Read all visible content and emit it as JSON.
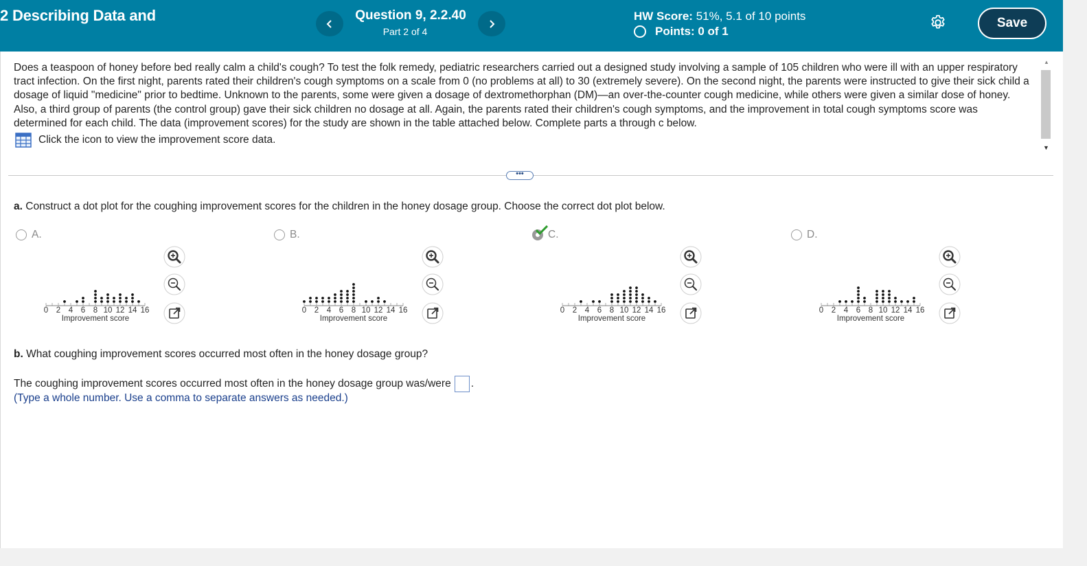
{
  "header": {
    "title": "2 Describing Data and",
    "question_title": "Question 9, 2.2.40",
    "question_part": "Part 2 of 4",
    "prev_icon": "chevron-left-icon",
    "next_icon": "chevron-right-icon",
    "hw_score_label": "HW Score:",
    "hw_score_value": "51%, 5.1 of 10 points",
    "points_text": "Points: 0 of 1",
    "settings_icon": "gear-icon",
    "save_label": "Save",
    "accent_color": "#007fa3"
  },
  "question": {
    "intro": "Does a teaspoon of honey before bed really calm a child's cough? To test the folk remedy, pediatric researchers carried out a designed study involving a sample of 105 children who were ill with an upper respiratory tract infection. On the first night, parents rated their children's cough symptoms on a scale from 0 (no problems at all) to 30 (extremely severe). On the second night, the parents were instructed to give their sick child a dosage of liquid \"medicine\" prior to bedtime. Unknown to the parents, some were given a dosage of dextromethorphan (DM)—an over-the-counter cough medicine, while others were given a similar dose of honey. Also, a third group of parents (the control group) gave their sick children no dosage at all. Again, the parents rated their children's cough symptoms, and the improvement in total cough symptoms score was determined for each child. The data (improvement scores) for the study are shown in the table attached below. Complete parts a through c below.",
    "data_link": "Click the icon to view the improvement score data.",
    "more_label": "•••",
    "part_a_letter": "a.",
    "part_a_text": "Construct a dot plot for the coughing improvement scores for the children in the honey dosage group. Choose the correct dot plot below.",
    "part_b_letter": "b.",
    "part_b_text": "What coughing improvement scores occurred most often in the honey dosage group?",
    "answer_prefix": "The coughing improvement scores occurred most often in the honey dosage group was/were",
    "answer_value": "",
    "answer_suffix": ".",
    "hint": "(Type a whole number. Use a comma to separate answers as needed.)"
  },
  "choices": [
    {
      "letter": "A.",
      "selected": false
    },
    {
      "letter": "B.",
      "selected": false
    },
    {
      "letter": "C.",
      "selected": true,
      "marked_correct": true
    },
    {
      "letter": "D.",
      "selected": false
    }
  ],
  "chart_data": [
    {
      "type": "scatter",
      "choice": "A",
      "xlabel": "Improvement score",
      "xticks": [
        "0",
        "2",
        "4",
        "6",
        "8",
        "10",
        "12",
        "14",
        "16"
      ],
      "xlim": [
        0,
        16
      ],
      "counts": {
        "3": 1,
        "5": 1,
        "6": 2,
        "8": 4,
        "9": 2,
        "10": 3,
        "11": 2,
        "12": 3,
        "13": 2,
        "14": 3,
        "15": 1
      }
    },
    {
      "type": "scatter",
      "choice": "B",
      "xlabel": "Improvement score",
      "xticks": [
        "0",
        "2",
        "4",
        "6",
        "8",
        "10",
        "12",
        "14",
        "16"
      ],
      "xlim": [
        0,
        16
      ],
      "counts": {
        "0": 1,
        "1": 2,
        "2": 2,
        "3": 2,
        "4": 2,
        "5": 3,
        "6": 4,
        "7": 4,
        "8": 6,
        "10": 1,
        "11": 1,
        "12": 2,
        "13": 1
      }
    },
    {
      "type": "scatter",
      "choice": "C",
      "xlabel": "Improvement score",
      "xticks": [
        "0",
        "2",
        "4",
        "6",
        "8",
        "10",
        "12",
        "14",
        "16"
      ],
      "xlim": [
        0,
        16
      ],
      "counts": {
        "3": 1,
        "5": 1,
        "6": 1,
        "8": 3,
        "9": 3,
        "10": 4,
        "11": 5,
        "12": 5,
        "13": 3,
        "14": 2,
        "15": 1
      }
    },
    {
      "type": "scatter",
      "choice": "D",
      "xlabel": "Improvement score",
      "xticks": [
        "0",
        "2",
        "4",
        "6",
        "8",
        "10",
        "12",
        "14",
        "16"
      ],
      "xlim": [
        0,
        16
      ],
      "counts": {
        "3": 1,
        "4": 1,
        "5": 1,
        "6": 5,
        "7": 2,
        "9": 4,
        "10": 4,
        "11": 4,
        "12": 2,
        "13": 1,
        "14": 1,
        "15": 2
      }
    }
  ]
}
